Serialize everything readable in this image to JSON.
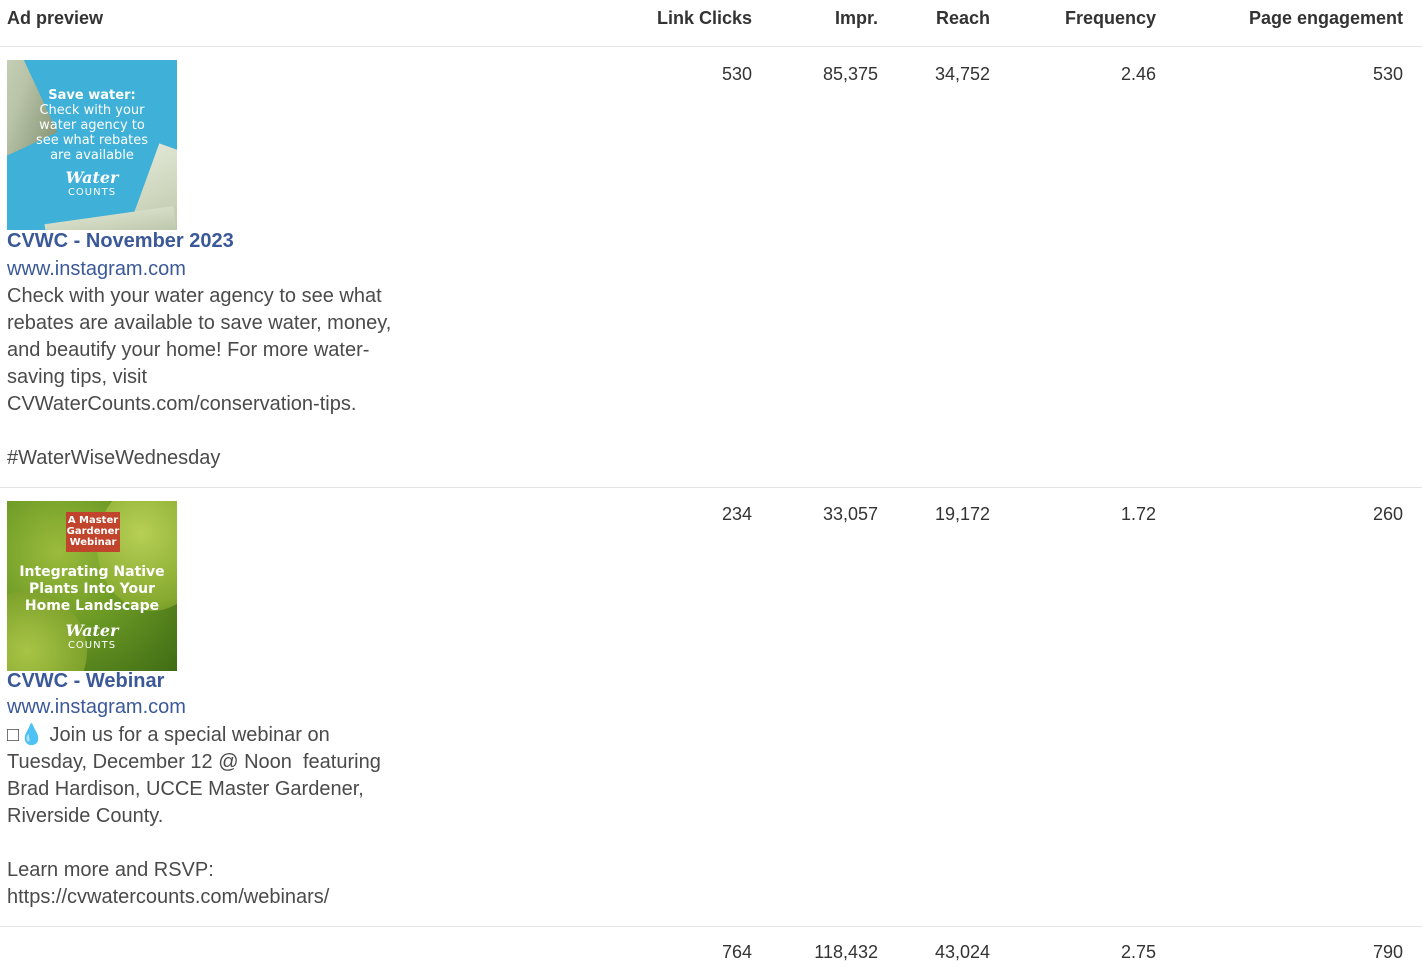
{
  "table": {
    "headers": {
      "ad_preview": "Ad preview",
      "link_clicks": "Link Clicks",
      "impressions": "Impr.",
      "reach": "Reach",
      "frequency": "Frequency",
      "page_engagement": "Page engagement"
    },
    "rows": [
      {
        "thumbnail": {
          "headline": "Save water:",
          "text": "Check with your\nwater agency to\nsee what rebates\nare available",
          "logo_word": "Water",
          "logo_sub": "COUNTS"
        },
        "title": "CVWC - November 2023",
        "link": "www.instagram.com",
        "body": "Check with your water agency to see what\nrebates are available to save water, money,\nand beautify your home! For more water-\nsaving tips, visit\nCVWaterCounts.com/conservation-tips.\n\n#WaterWiseWednesday",
        "link_clicks": "530",
        "impressions": "85,375",
        "reach": "34,752",
        "frequency": "2.46",
        "page_engagement": "530"
      },
      {
        "thumbnail": {
          "badge": "A Master\nGardener\nWebinar",
          "text": "Integrating Native\nPlants Into Your\nHome Landscape",
          "logo_word": "Water",
          "logo_sub": "COUNTS"
        },
        "title": "CVWC - Webinar",
        "link": "www.instagram.com",
        "body": "□💧 Join us for a special webinar on\nTuesday, December 12 @ Noon  featuring\nBrad Hardison, UCCE Master Gardener,\nRiverside County.\n\nLearn more and RSVP:\nhttps://cvwatercounts.com/webinars/",
        "link_clicks": "234",
        "impressions": "33,057",
        "reach": "19,172",
        "frequency": "1.72",
        "page_engagement": "260"
      }
    ],
    "totals": {
      "link_clicks": "764",
      "impressions": "118,432",
      "reach": "43,024",
      "frequency": "2.75",
      "page_engagement": "790"
    }
  }
}
